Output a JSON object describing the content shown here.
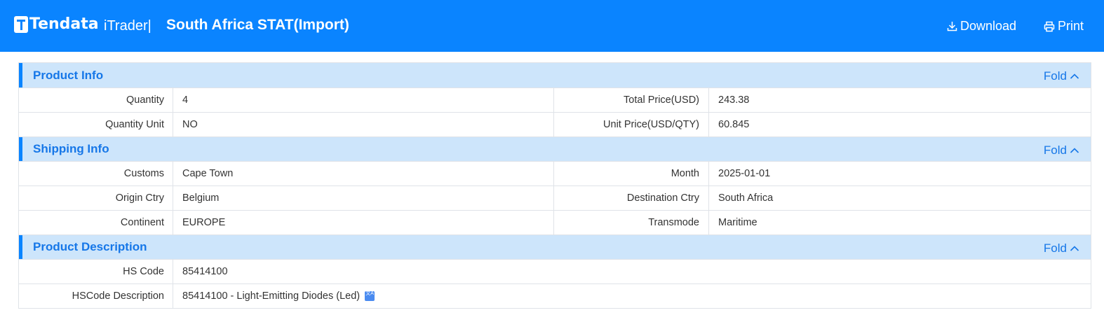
{
  "header": {
    "logo_text": "Tendata",
    "product_name": "iTrader|",
    "title": "South Africa STAT(Import)",
    "download_label": "Download",
    "print_label": "Print"
  },
  "sections": [
    {
      "title": "Product Info",
      "fold_label": "Fold",
      "rows": [
        {
          "label1": "Quantity",
          "value1": "4",
          "label2": "Total Price(USD)",
          "value2": "243.38"
        },
        {
          "label1": "Quantity Unit",
          "value1": "NO",
          "label2": "Unit Price(USD/QTY)",
          "value2": "60.845"
        }
      ]
    },
    {
      "title": "Shipping Info",
      "fold_label": "Fold",
      "rows": [
        {
          "label1": "Customs",
          "value1": "Cape Town",
          "label2": "Month",
          "value2": "2025-01-01"
        },
        {
          "label1": "Origin Ctry",
          "value1": "Belgium",
          "label2": "Destination Ctry",
          "value2": "South Africa"
        },
        {
          "label1": "Continent",
          "value1": "EUROPE",
          "label2": "Transmode",
          "value2": "Maritime"
        }
      ]
    },
    {
      "title": "Product Description",
      "fold_label": "Fold",
      "rows": [
        {
          "label1": "HS Code",
          "value1": "85414100"
        },
        {
          "label1": "HSCode Description",
          "value1": "85414100 - Light-Emitting Diodes (Led)"
        }
      ]
    }
  ],
  "colors": {
    "header_bg": "#0a84ff",
    "section_bg": "#cde5fb",
    "section_title": "#1677e8"
  }
}
